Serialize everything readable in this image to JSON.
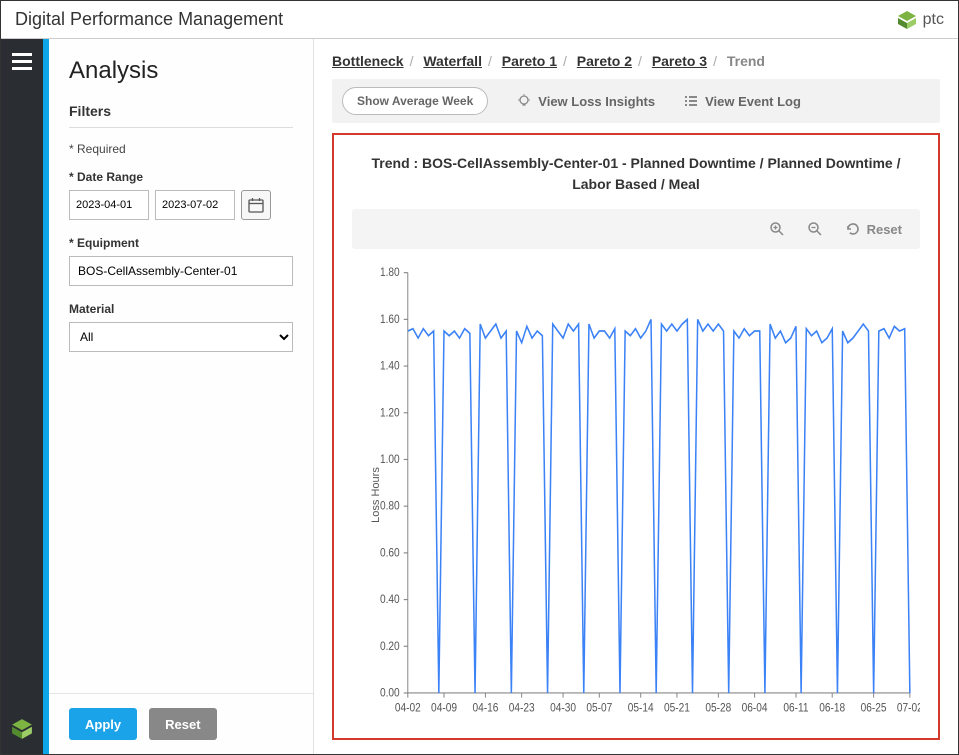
{
  "app_title": "Digital Performance Management",
  "logo_text": "ptc",
  "sidebar": {
    "page_title": "Analysis",
    "filters_header": "Filters",
    "required_note": "* Required",
    "date_range_label": "* Date Range",
    "date_start": "2023-04-01",
    "date_end": "2023-07-02",
    "equipment_label": "* Equipment",
    "equipment_value": "BOS-CellAssembly-Center-01",
    "material_label": "Material",
    "material_value": "All",
    "apply_label": "Apply",
    "reset_label": "Reset"
  },
  "breadcrumbs": {
    "b1": "Bottleneck",
    "b2": "Waterfall",
    "b3": "Pareto 1",
    "b4": "Pareto 2",
    "b5": "Pareto 3",
    "b6": "Trend"
  },
  "toolbar": {
    "avg_week": "Show Average Week",
    "loss_insights": "View Loss Insights",
    "event_log": "View Event Log"
  },
  "chart": {
    "title": "Trend : BOS-CellAssembly-Center-01 - Planned Downtime / Planned Downtime / Labor Based / Meal",
    "reset_label": "Reset",
    "ylabel": "Loss Hours"
  },
  "chart_data": {
    "type": "line",
    "title": "Trend : BOS-CellAssembly-Center-01 - Planned Downtime / Planned Downtime / Labor Based / Meal",
    "xlabel": "",
    "ylabel": "Loss Hours",
    "ylim": [
      0.0,
      1.8
    ],
    "yticks": [
      0.0,
      0.2,
      0.4,
      0.6,
      0.8,
      1.0,
      1.2,
      1.4,
      1.6,
      1.8
    ],
    "xticks": [
      "04-02",
      "04-09",
      "04-16",
      "04-23",
      "04-30",
      "05-07",
      "05-14",
      "05-21",
      "05-28",
      "06-04",
      "06-11",
      "06-18",
      "06-25",
      "07-02"
    ],
    "series": [
      {
        "name": "Loss Hours",
        "values": [
          1.55,
          1.56,
          1.52,
          1.56,
          1.53,
          1.55,
          0.0,
          1.55,
          1.53,
          1.55,
          1.52,
          1.56,
          1.54,
          0.0,
          1.58,
          1.52,
          1.55,
          1.58,
          1.52,
          1.55,
          0.0,
          1.55,
          1.5,
          1.57,
          1.52,
          1.55,
          1.53,
          0.0,
          1.58,
          1.55,
          1.52,
          1.58,
          1.55,
          1.58,
          0.0,
          1.58,
          1.52,
          1.55,
          1.55,
          1.52,
          1.56,
          0.0,
          1.55,
          1.53,
          1.56,
          1.52,
          1.55,
          1.6,
          0.0,
          1.58,
          1.55,
          1.58,
          1.55,
          1.58,
          1.6,
          0.0,
          1.6,
          1.55,
          1.58,
          1.55,
          1.58,
          1.55,
          0.0,
          1.55,
          1.52,
          1.56,
          1.53,
          1.55,
          1.55,
          0.0,
          1.58,
          1.52,
          1.55,
          1.5,
          1.52,
          1.57,
          0.0,
          1.56,
          1.53,
          1.55,
          1.5,
          1.52,
          1.56,
          0.0,
          1.55,
          1.5,
          1.52,
          1.55,
          1.58,
          1.55,
          0.0,
          1.55,
          1.56,
          1.52,
          1.57,
          1.55,
          1.56,
          0.0
        ]
      }
    ]
  }
}
